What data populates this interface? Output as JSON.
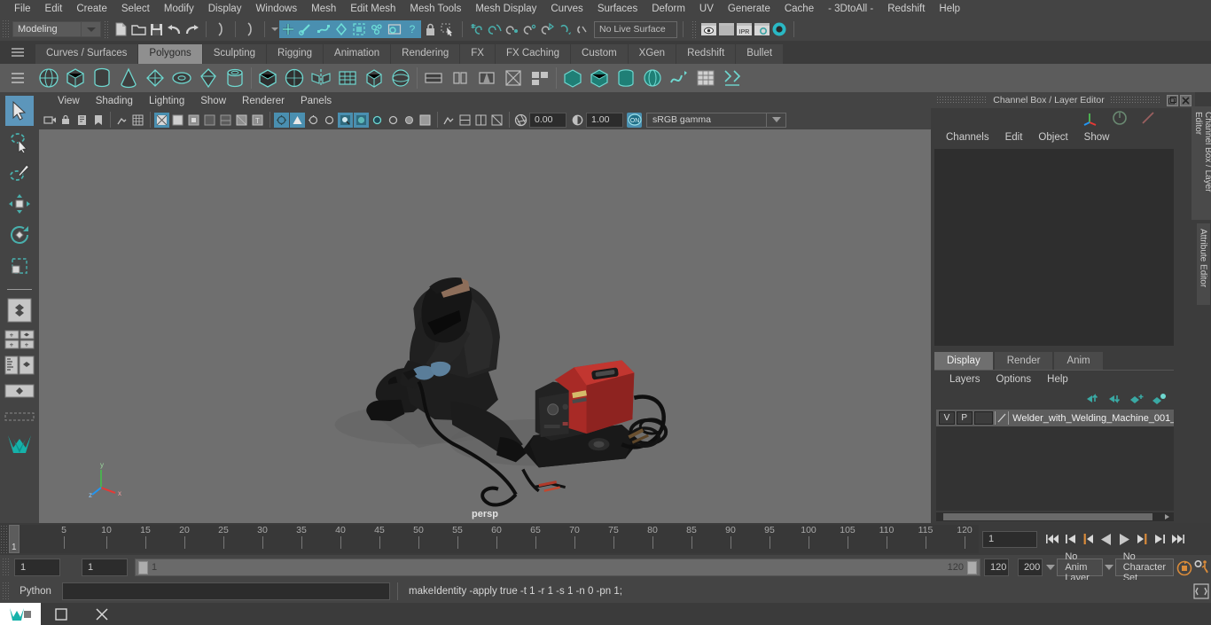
{
  "menubar": {
    "items": [
      "File",
      "Edit",
      "Create",
      "Select",
      "Modify",
      "Display",
      "Windows",
      "Mesh",
      "Edit Mesh",
      "Mesh Tools",
      "Mesh Display",
      "Curves",
      "Surfaces",
      "Deform",
      "UV",
      "Generate",
      "Cache",
      "- 3DtoAll -",
      "Redshift",
      "Help"
    ]
  },
  "statusline": {
    "menuset": "Modeling",
    "live_surface": "No Live Surface",
    "icons": [
      "new-scene-icon",
      "open-scene-icon",
      "save-scene-icon",
      "undo-icon",
      "redo-icon",
      "select-by-hierarchy-icon",
      "select-by-object-icon",
      "select-by-component-icon",
      "select-hierarchy-arrow-icon",
      "selection-mask-dropdown-icon",
      "select-tool-icon",
      "paint-select-icon",
      "lasso-select-icon",
      "soft-select-icon",
      "symmetry-icon",
      "marking-menu-icon",
      "render-settings-icon",
      "help-icon",
      "lock-icon",
      "selection-highlight-icon",
      "snap-to-grid-icon",
      "snap-to-curve-icon",
      "snap-to-point-icon",
      "snap-to-projected-center-icon",
      "snap-to-view-plane-icon",
      "make-live-icon",
      "render-view-icon",
      "render-current-frame-icon",
      "ipr-render-icon",
      "render-settings-window-icon",
      "hypershade-icon"
    ]
  },
  "shelf": {
    "tabs": [
      "Curves / Surfaces",
      "Polygons",
      "Sculpting",
      "Rigging",
      "Animation",
      "Rendering",
      "FX",
      "FX Caching",
      "Custom",
      "XGen",
      "Redshift",
      "Bullet"
    ],
    "selected_tab": "Polygons",
    "buttons": [
      "poly-sphere-icon",
      "poly-cube-icon",
      "poly-cylinder-icon",
      "poly-cone-icon",
      "poly-torus-icon",
      "poly-plane-icon",
      "poly-prism-icon",
      "poly-pipe-icon",
      "poly-combine-icon",
      "poly-smooth-icon",
      "poly-mirror-icon",
      "poly-grid-icon",
      "poly-bevel-icon",
      "poly-bridge-icon",
      "poly-extrude-icon",
      "poly-append-icon",
      "poly-multicut-icon",
      "poly-target-weld-icon",
      "poly-boolean-icon",
      "poly-quad-draw-icon",
      "poly-reduce-icon",
      "poly-triangulate-icon",
      "poly-planar-icon",
      "uv-editor-icon",
      "uv-automatic-icon",
      "uv-cylindrical-icon",
      "uv-planar-icon",
      "uv-unfold-icon",
      "uv-layout-icon",
      "uv-cut-icon"
    ]
  },
  "toolbox": {
    "tools": [
      "select-tool-icon",
      "lasso-select-tool-icon",
      "paint-select-tool-icon",
      "move-tool-icon",
      "rotate-tool-icon",
      "scale-tool-icon"
    ],
    "selected_tool": "select-tool-icon",
    "layouts": [
      "single-perspective-view-icon",
      "four-view-layout-icon",
      "outliner-persp-layout-icon",
      "hypergraph-persp-layout-icon",
      "persp-graph-layout-icon"
    ]
  },
  "viewport": {
    "menus": [
      "View",
      "Shading",
      "Lighting",
      "Show",
      "Renderer",
      "Panels"
    ],
    "camera_label": "persp",
    "exposure": "0.00",
    "gamma_value": "1.00",
    "color_management": "sRGB gamma",
    "gate_toggle": "ON",
    "axis_labels": {
      "x": "x",
      "y": "y",
      "z": "z"
    },
    "background_color": "#6f6f6f",
    "model_subject": "welder-kneeling-with-welding-machine",
    "machine_color": "#b02a2a"
  },
  "right_panel": {
    "title": "Channel Box / Layer Editor",
    "menus": [
      "Channels",
      "Edit",
      "Object",
      "Show"
    ],
    "side_tabs": [
      "Channel Box / Layer Editor",
      "Attribute Editor"
    ],
    "layer_tabs": [
      "Display",
      "Render",
      "Anim"
    ],
    "layer_selected_tab": "Display",
    "layer_menus": [
      "Layers",
      "Options",
      "Help"
    ],
    "layers": [
      {
        "visibility": "V",
        "playback": "P",
        "type": "",
        "name": "Welder_with_Welding_Machine_001_"
      }
    ]
  },
  "timeline": {
    "ticks": [
      5,
      10,
      15,
      20,
      25,
      30,
      35,
      40,
      45,
      50,
      55,
      60,
      65,
      70,
      75,
      80,
      85,
      90,
      95,
      100,
      105,
      110,
      115,
      120
    ],
    "current_frame_label": "1",
    "frame_field": "1",
    "playback_buttons": [
      "go-to-start-icon",
      "step-back-keyframe-icon",
      "step-back-frame-icon",
      "play-backwards-icon",
      "play-forwards-icon",
      "step-forward-frame-icon",
      "step-forward-keyframe-icon",
      "go-to-end-icon"
    ]
  },
  "range": {
    "anim_start": "1",
    "range_start": "1",
    "bar_start": "1",
    "bar_end": "120",
    "range_end": "120",
    "anim_end": "200",
    "anim_layer": "No Anim Layer",
    "character_set": "No Character Set",
    "auto_key_icon": "auto-keyframe-icon",
    "anim_prefs_icon": "animation-preferences-icon"
  },
  "command_line": {
    "language": "Python",
    "input_value": "",
    "result": "makeIdentity -apply true -t 1 -r 1 -s 1 -n 0 -pn 1;",
    "script_editor_icon": "script-editor-icon"
  },
  "taskbar": {
    "items": [
      "maya-app-icon",
      "window-restore-icon",
      "close-icon"
    ]
  }
}
